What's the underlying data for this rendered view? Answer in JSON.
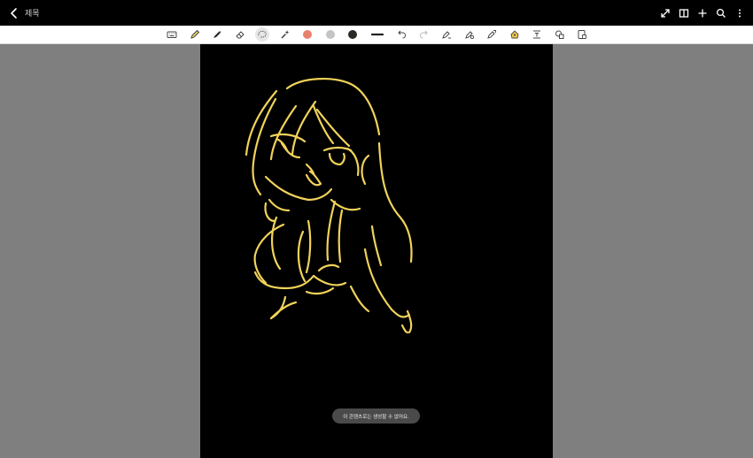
{
  "header": {
    "title": "제목"
  },
  "toolbar": {
    "colors": {
      "salmon": "#e8826f",
      "gray": "#c4c4c4",
      "dark": "#2a2a24"
    },
    "active_tool": "lasso"
  },
  "canvas": {
    "background": "#000000",
    "stroke_color": "#f1d35a"
  },
  "toast": {
    "message": "이 콘텐츠로는 생성할 수 없어요."
  }
}
